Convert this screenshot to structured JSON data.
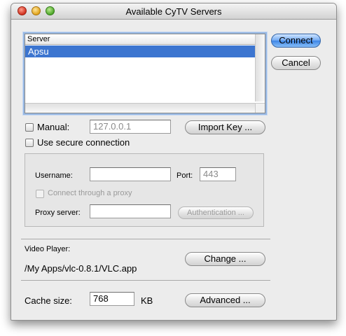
{
  "window": {
    "title": "Available CyTV Servers"
  },
  "server_list": {
    "header": "Server",
    "rows": [
      "Apsu"
    ]
  },
  "buttons": {
    "connect": "Connect",
    "cancel": "Cancel",
    "import_key": "Import Key ...",
    "authentication": "Authentication ...",
    "change": "Change ...",
    "advanced": "Advanced ..."
  },
  "manual": {
    "label": "Manual:",
    "checked": false,
    "address": "127.0.0.1"
  },
  "secure": {
    "label": "Use secure connection",
    "checked": false
  },
  "credentials": {
    "username_label": "Username:",
    "username_value": "",
    "port_label": "Port:",
    "port_value": "443",
    "proxy_checkbox_label": "Connect through a proxy",
    "proxy_checked": false,
    "proxy_server_label": "Proxy server:",
    "proxy_server_value": ""
  },
  "video_player": {
    "label": "Video Player:",
    "path": "/My Apps/vlc-0.8.1/VLC.app"
  },
  "cache": {
    "label": "Cache size:",
    "value": "768",
    "unit": "KB"
  },
  "colors": {
    "selection": "#3c75d0",
    "default_button": "#5a9bf0",
    "window_bg": "#ececec"
  }
}
